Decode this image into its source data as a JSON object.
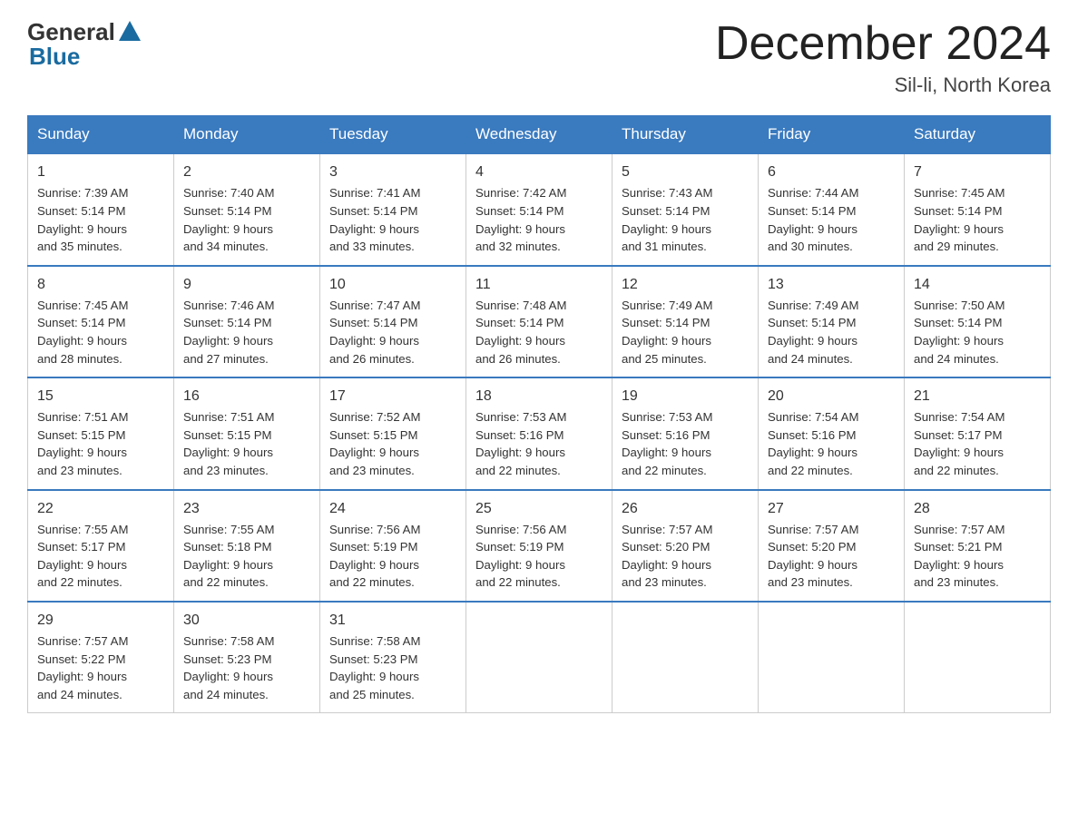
{
  "logo": {
    "general": "General",
    "blue": "Blue"
  },
  "title": "December 2024",
  "subtitle": "Sil-li, North Korea",
  "days_of_week": [
    "Sunday",
    "Monday",
    "Tuesday",
    "Wednesday",
    "Thursday",
    "Friday",
    "Saturday"
  ],
  "weeks": [
    [
      {
        "day": "1",
        "sunrise": "7:39 AM",
        "sunset": "5:14 PM",
        "daylight": "9 hours and 35 minutes."
      },
      {
        "day": "2",
        "sunrise": "7:40 AM",
        "sunset": "5:14 PM",
        "daylight": "9 hours and 34 minutes."
      },
      {
        "day": "3",
        "sunrise": "7:41 AM",
        "sunset": "5:14 PM",
        "daylight": "9 hours and 33 minutes."
      },
      {
        "day": "4",
        "sunrise": "7:42 AM",
        "sunset": "5:14 PM",
        "daylight": "9 hours and 32 minutes."
      },
      {
        "day": "5",
        "sunrise": "7:43 AM",
        "sunset": "5:14 PM",
        "daylight": "9 hours and 31 minutes."
      },
      {
        "day": "6",
        "sunrise": "7:44 AM",
        "sunset": "5:14 PM",
        "daylight": "9 hours and 30 minutes."
      },
      {
        "day": "7",
        "sunrise": "7:45 AM",
        "sunset": "5:14 PM",
        "daylight": "9 hours and 29 minutes."
      }
    ],
    [
      {
        "day": "8",
        "sunrise": "7:45 AM",
        "sunset": "5:14 PM",
        "daylight": "9 hours and 28 minutes."
      },
      {
        "day": "9",
        "sunrise": "7:46 AM",
        "sunset": "5:14 PM",
        "daylight": "9 hours and 27 minutes."
      },
      {
        "day": "10",
        "sunrise": "7:47 AM",
        "sunset": "5:14 PM",
        "daylight": "9 hours and 26 minutes."
      },
      {
        "day": "11",
        "sunrise": "7:48 AM",
        "sunset": "5:14 PM",
        "daylight": "9 hours and 26 minutes."
      },
      {
        "day": "12",
        "sunrise": "7:49 AM",
        "sunset": "5:14 PM",
        "daylight": "9 hours and 25 minutes."
      },
      {
        "day": "13",
        "sunrise": "7:49 AM",
        "sunset": "5:14 PM",
        "daylight": "9 hours and 24 minutes."
      },
      {
        "day": "14",
        "sunrise": "7:50 AM",
        "sunset": "5:14 PM",
        "daylight": "9 hours and 24 minutes."
      }
    ],
    [
      {
        "day": "15",
        "sunrise": "7:51 AM",
        "sunset": "5:15 PM",
        "daylight": "9 hours and 23 minutes."
      },
      {
        "day": "16",
        "sunrise": "7:51 AM",
        "sunset": "5:15 PM",
        "daylight": "9 hours and 23 minutes."
      },
      {
        "day": "17",
        "sunrise": "7:52 AM",
        "sunset": "5:15 PM",
        "daylight": "9 hours and 23 minutes."
      },
      {
        "day": "18",
        "sunrise": "7:53 AM",
        "sunset": "5:16 PM",
        "daylight": "9 hours and 22 minutes."
      },
      {
        "day": "19",
        "sunrise": "7:53 AM",
        "sunset": "5:16 PM",
        "daylight": "9 hours and 22 minutes."
      },
      {
        "day": "20",
        "sunrise": "7:54 AM",
        "sunset": "5:16 PM",
        "daylight": "9 hours and 22 minutes."
      },
      {
        "day": "21",
        "sunrise": "7:54 AM",
        "sunset": "5:17 PM",
        "daylight": "9 hours and 22 minutes."
      }
    ],
    [
      {
        "day": "22",
        "sunrise": "7:55 AM",
        "sunset": "5:17 PM",
        "daylight": "9 hours and 22 minutes."
      },
      {
        "day": "23",
        "sunrise": "7:55 AM",
        "sunset": "5:18 PM",
        "daylight": "9 hours and 22 minutes."
      },
      {
        "day": "24",
        "sunrise": "7:56 AM",
        "sunset": "5:19 PM",
        "daylight": "9 hours and 22 minutes."
      },
      {
        "day": "25",
        "sunrise": "7:56 AM",
        "sunset": "5:19 PM",
        "daylight": "9 hours and 22 minutes."
      },
      {
        "day": "26",
        "sunrise": "7:57 AM",
        "sunset": "5:20 PM",
        "daylight": "9 hours and 23 minutes."
      },
      {
        "day": "27",
        "sunrise": "7:57 AM",
        "sunset": "5:20 PM",
        "daylight": "9 hours and 23 minutes."
      },
      {
        "day": "28",
        "sunrise": "7:57 AM",
        "sunset": "5:21 PM",
        "daylight": "9 hours and 23 minutes."
      }
    ],
    [
      {
        "day": "29",
        "sunrise": "7:57 AM",
        "sunset": "5:22 PM",
        "daylight": "9 hours and 24 minutes."
      },
      {
        "day": "30",
        "sunrise": "7:58 AM",
        "sunset": "5:23 PM",
        "daylight": "9 hours and 24 minutes."
      },
      {
        "day": "31",
        "sunrise": "7:58 AM",
        "sunset": "5:23 PM",
        "daylight": "9 hours and 25 minutes."
      },
      null,
      null,
      null,
      null
    ]
  ],
  "label_sunrise": "Sunrise:",
  "label_sunset": "Sunset:",
  "label_daylight": "Daylight:"
}
